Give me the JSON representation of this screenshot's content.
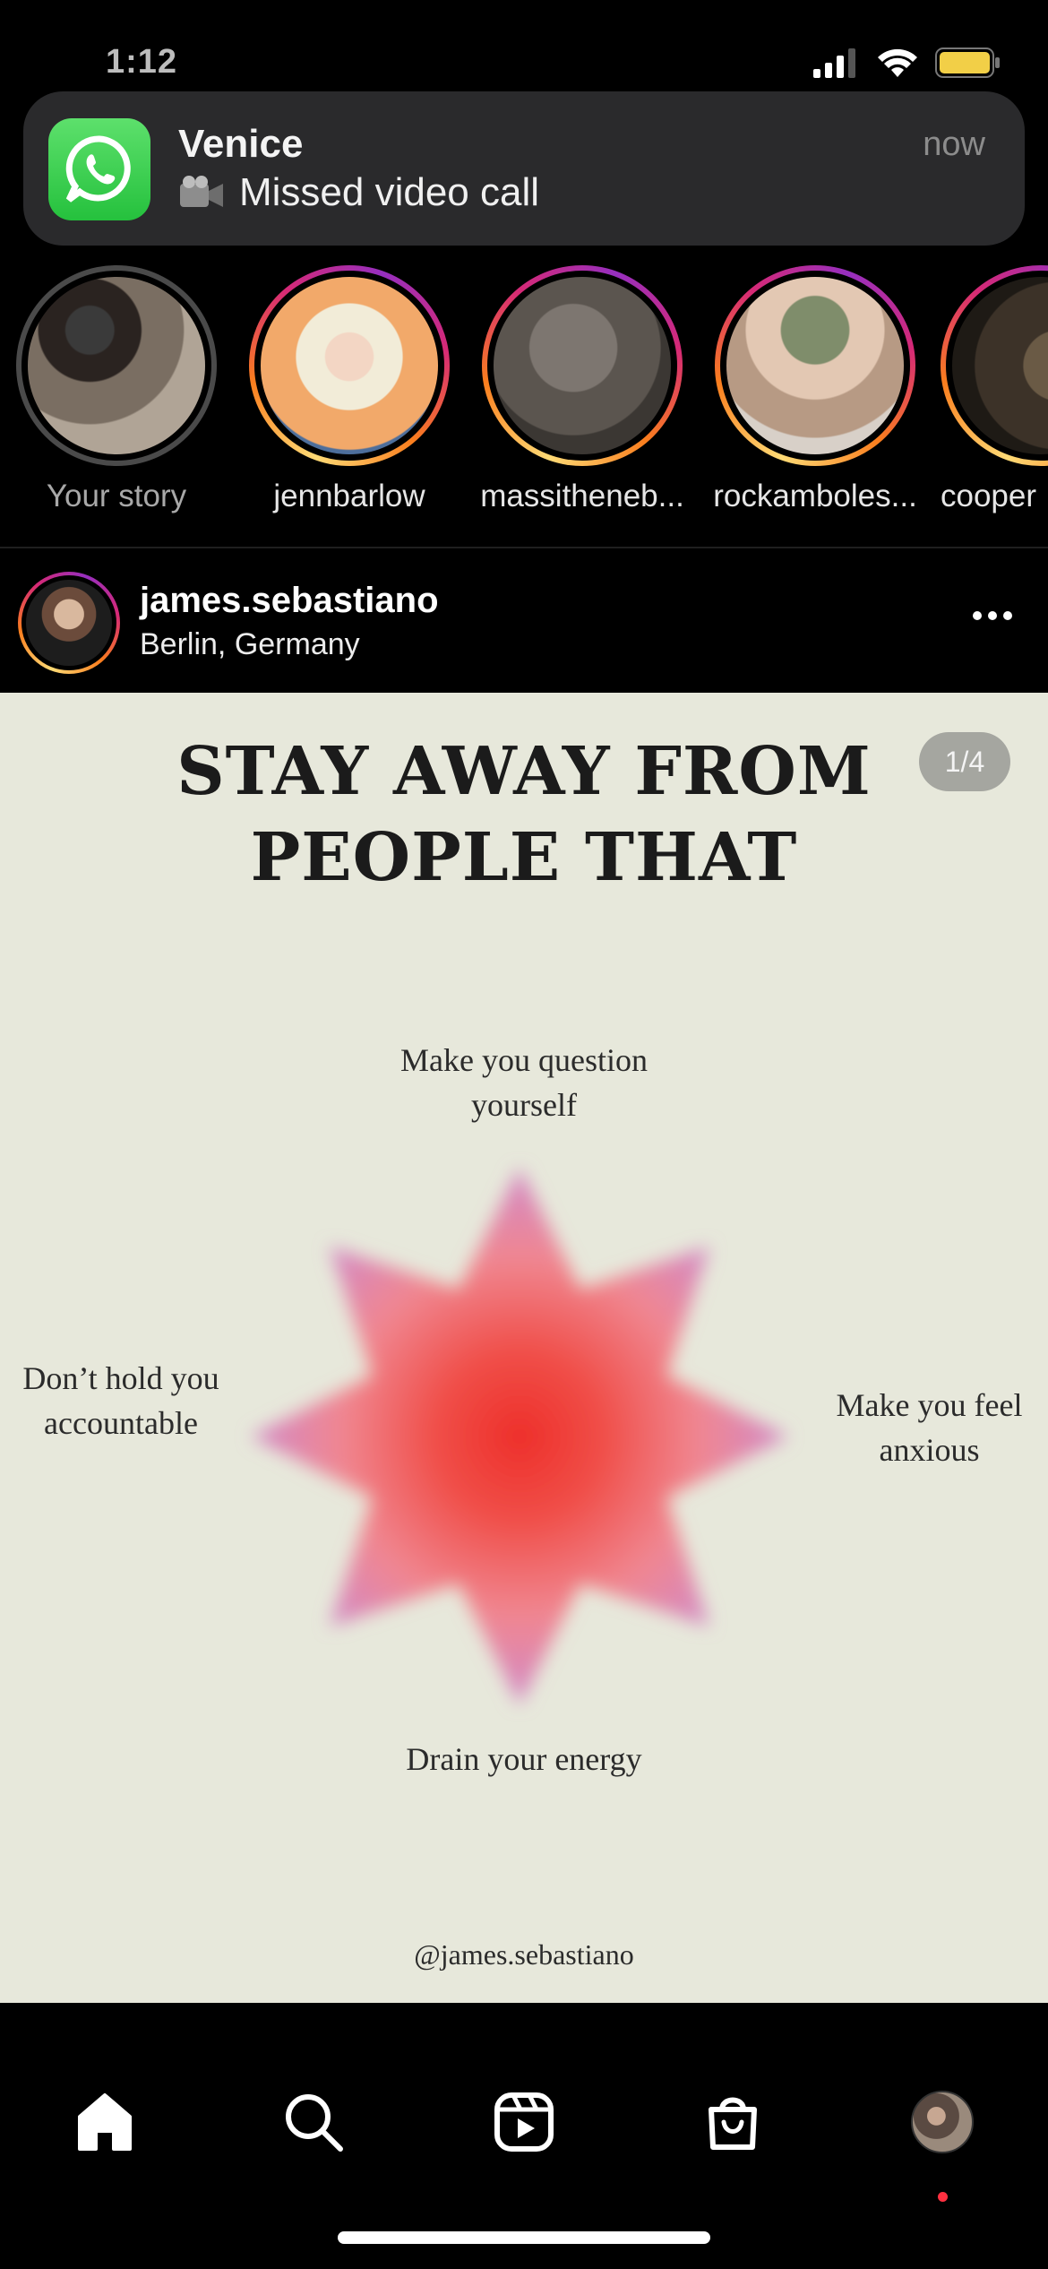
{
  "status_bar": {
    "time": "1:12"
  },
  "notification": {
    "app": "WhatsApp",
    "title": "Venice",
    "body": "Missed video call",
    "time": "now"
  },
  "stories": [
    {
      "label": "Your story",
      "seen": true
    },
    {
      "label": "jennbarlow",
      "seen": false
    },
    {
      "label": "massitheneb...",
      "seen": false
    },
    {
      "label": "rockamboles...",
      "seen": false
    },
    {
      "label": "cooper",
      "seen": false
    }
  ],
  "post": {
    "username": "james.sebastiano",
    "location": "Berlin, Germany",
    "page_indicator": "1/4",
    "title_line1": "STAY AWAY FROM",
    "title_line2": "PEOPLE THAT",
    "label_top": "Make you question yourself",
    "label_right": "Make you feel anxious",
    "label_bottom": "Drain your energy",
    "label_left": "Don’t hold you accountable",
    "handle": "@james.sebastiano"
  },
  "tab_bar": {
    "items": [
      "home-icon",
      "search-icon",
      "reels-icon",
      "shop-icon",
      "profile-avatar"
    ],
    "active": "home-icon",
    "profile_has_notification": true
  },
  "colors": {
    "background": "#000000",
    "post_bg": "#e7e8db",
    "whatsapp_green": "#25c13d",
    "notification_bg": "#2a2a2c",
    "star_center": "#ee3a34",
    "star_edge": "#c88ad8"
  }
}
